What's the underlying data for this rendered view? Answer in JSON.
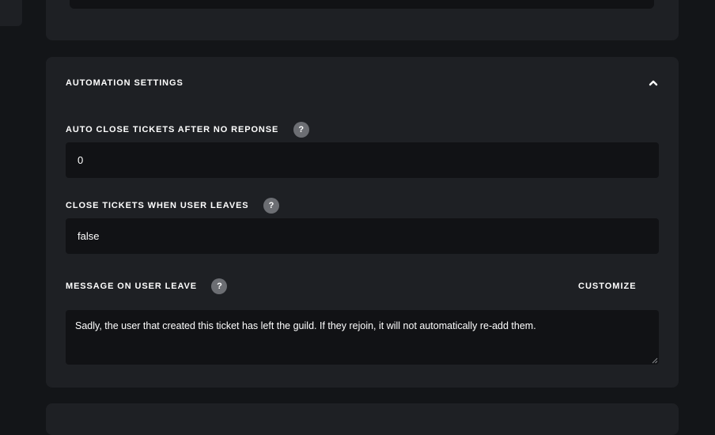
{
  "automation": {
    "title": "AUTOMATION SETTINGS",
    "auto_close": {
      "label": "AUTO CLOSE TICKETS AFTER NO REPONSE",
      "value": "0"
    },
    "close_on_leave": {
      "label": "CLOSE TICKETS WHEN USER LEAVES",
      "value": "false"
    },
    "leave_message": {
      "label": "MESSAGE ON USER LEAVE",
      "customize_label": "CUSTOMIZE",
      "value": "Sadly, the user that created this ticket has left the guild. If they rejoin, it will not automatically re-add them."
    },
    "help_glyph": "?"
  },
  "icons": {
    "collapse": "chevron-up-icon",
    "help": "question-mark-icon",
    "resize": "resize-handle-icon"
  },
  "colors": {
    "page_background": "#131518",
    "card_background": "#1e2024",
    "input_background": "#111215",
    "help_icon_background": "#6c6e73",
    "text": "#ffffff"
  }
}
